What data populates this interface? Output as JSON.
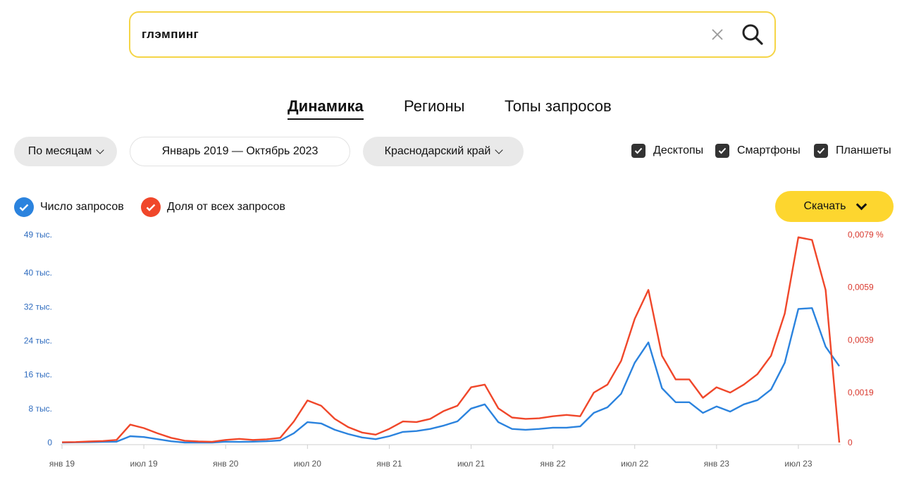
{
  "search": {
    "query": "глэмпинг"
  },
  "tabs": [
    {
      "label": "Динамика",
      "active": true
    },
    {
      "label": "Регионы",
      "active": false
    },
    {
      "label": "Топы запросов",
      "active": false
    }
  ],
  "filters": {
    "period": "По месяцам",
    "date_range": "Январь 2019 — Октябрь 2023",
    "region": "Краснодарский край"
  },
  "devices": [
    {
      "label": "Десктопы",
      "checked": true
    },
    {
      "label": "Смартфоны",
      "checked": true
    },
    {
      "label": "Планшеты",
      "checked": true
    }
  ],
  "legend": [
    {
      "label": "Число запросов",
      "color": "#2b83de",
      "checked": true
    },
    {
      "label": "Доля от всех запросов",
      "color": "#f0472a",
      "checked": true
    }
  ],
  "download_label": "Скачать",
  "chart_data": {
    "type": "line",
    "y_left_ticks": [
      "0",
      "8 тыс.",
      "16 тыс.",
      "24 тыс.",
      "32 тыс.",
      "40 тыс.",
      "49 тыс."
    ],
    "y_left_tick_values": [
      0,
      8000,
      16000,
      24000,
      32000,
      40000,
      49000
    ],
    "y_right_ticks": [
      "0",
      "0,0019",
      "0,0039",
      "0,0059",
      "0,0079 %"
    ],
    "y_right_tick_values": [
      0,
      0.0019,
      0.0039,
      0.0059,
      0.0079
    ],
    "x_ticks": [
      {
        "label": "янв 19",
        "index": 0
      },
      {
        "label": "июл 19",
        "index": 6
      },
      {
        "label": "янв 20",
        "index": 12
      },
      {
        "label": "июл 20",
        "index": 18
      },
      {
        "label": "янв 21",
        "index": 24
      },
      {
        "label": "июл 21",
        "index": 30
      },
      {
        "label": "янв 22",
        "index": 36
      },
      {
        "label": "июл 22",
        "index": 42
      },
      {
        "label": "янв 23",
        "index": 48
      },
      {
        "label": "июл 23",
        "index": 54
      }
    ],
    "ylim_left": [
      0,
      49000
    ],
    "ylim_right": [
      0,
      0.0079
    ],
    "series": [
      {
        "name": "Число запросов",
        "color": "#2b83de",
        "axis": "left",
        "values": [
          0,
          50,
          100,
          150,
          200,
          1500,
          1300,
          800,
          300,
          0,
          -50,
          0,
          200,
          150,
          200,
          300,
          500,
          2200,
          4800,
          4500,
          3000,
          2000,
          1200,
          800,
          1500,
          2500,
          2700,
          3200,
          4000,
          5000,
          8000,
          9000,
          4800,
          3200,
          3000,
          3200,
          3500,
          3500,
          3800,
          7000,
          8300,
          11500,
          18800,
          23600,
          12800,
          9500,
          9500,
          7000,
          8500,
          7300,
          9000,
          10000,
          12500,
          18800,
          31500,
          31700,
          22600,
          18000
        ]
      },
      {
        "name": "Доля от всех запросов",
        "color": "#f0472a",
        "axis": "right",
        "values": [
          1e-05,
          2e-05,
          4e-05,
          6e-05,
          0.0001,
          0.00068,
          0.00055,
          0.00035,
          0.00018,
          7e-05,
          4e-05,
          3e-05,
          0.0001,
          0.00014,
          0.0001,
          0.00012,
          0.00018,
          0.0008,
          0.0016,
          0.0014,
          0.0009,
          0.00058,
          0.00038,
          0.0003,
          0.00052,
          0.0008,
          0.00078,
          0.0009,
          0.0012,
          0.0014,
          0.0021,
          0.0022,
          0.0013,
          0.00095,
          0.0009,
          0.00092,
          0.001,
          0.00105,
          0.001,
          0.0019,
          0.0022,
          0.0031,
          0.0047,
          0.0058,
          0.0033,
          0.0024,
          0.0024,
          0.0017,
          0.0021,
          0.0019,
          0.0022,
          0.0026,
          0.0033,
          0.0049,
          0.0078,
          0.0077,
          0.0058,
          0
        ]
      }
    ]
  }
}
